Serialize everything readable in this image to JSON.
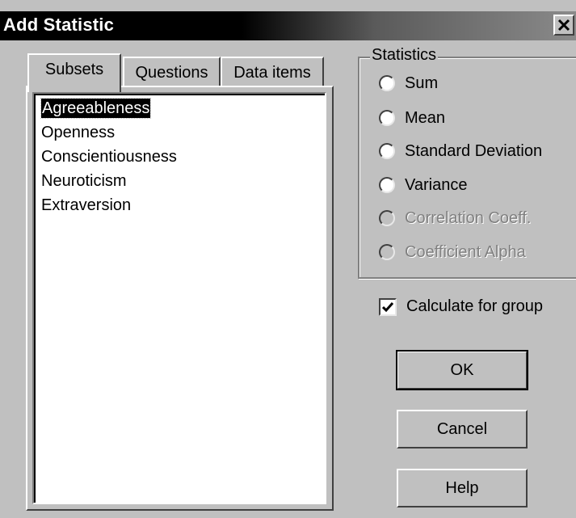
{
  "window": {
    "title": "Add Statistic"
  },
  "tabs": [
    {
      "label": "Subsets"
    },
    {
      "label": "Questions"
    },
    {
      "label": "Data items"
    }
  ],
  "list": {
    "items": [
      "Agreeableness",
      "Openness",
      "Conscientiousness",
      "Neuroticism",
      "Extraversion"
    ],
    "selected": "Agreeableness"
  },
  "statistics": {
    "legend": "Statistics",
    "options": [
      {
        "label": "Sum",
        "enabled": true
      },
      {
        "label": "Mean",
        "enabled": true
      },
      {
        "label": "Standard Deviation",
        "enabled": true
      },
      {
        "label": "Variance",
        "enabled": true
      },
      {
        "label": "Correlation Coeff.",
        "enabled": false
      },
      {
        "label": "Coefficient Alpha",
        "enabled": false
      }
    ]
  },
  "calculate_for_group": {
    "label": "Calculate for group",
    "checked": true
  },
  "buttons": {
    "ok": "OK",
    "cancel": "Cancel",
    "help": "Help"
  },
  "icons": {
    "close": "close-icon",
    "check": "checkmark-icon"
  }
}
